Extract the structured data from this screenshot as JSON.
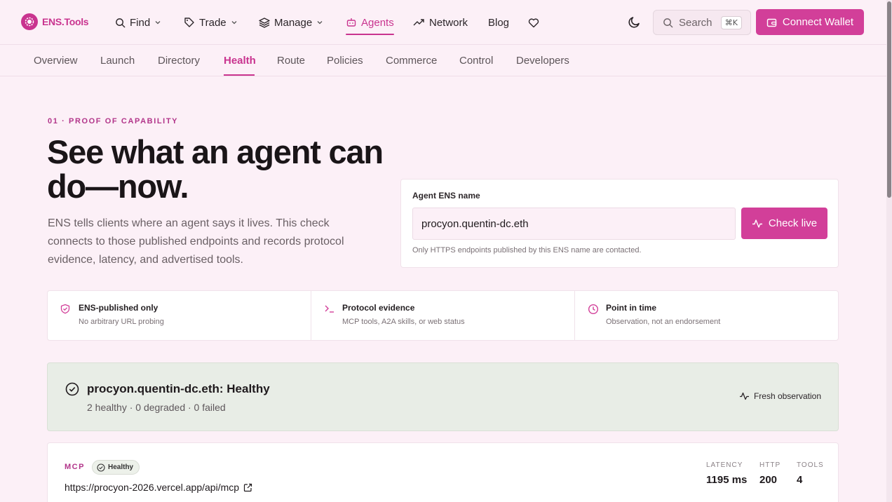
{
  "brand": {
    "name": "ENS.Tools"
  },
  "topnav": {
    "items": [
      {
        "label": "Find",
        "icon": "search-icon",
        "dropdown": true
      },
      {
        "label": "Trade",
        "icon": "tag-icon",
        "dropdown": true
      },
      {
        "label": "Manage",
        "icon": "layers-icon",
        "dropdown": true
      },
      {
        "label": "Agents",
        "icon": "bot-icon",
        "active": true
      },
      {
        "label": "Network",
        "icon": "trending-up-icon"
      },
      {
        "label": "Blog"
      }
    ],
    "search_label": "Search",
    "search_shortcut": "⌘K",
    "connect_label": "Connect Wallet"
  },
  "subnav": {
    "items": [
      "Overview",
      "Launch",
      "Directory",
      "Health",
      "Route",
      "Policies",
      "Commerce",
      "Control",
      "Developers"
    ],
    "active": "Health"
  },
  "hero": {
    "eyebrow": "01 · PROOF OF CAPABILITY",
    "title": "See what an agent can do—now.",
    "description": "ENS tells clients where an agent says it lives. This check connects to those published endpoints and records protocol evidence, latency, and advertised tools."
  },
  "check": {
    "label": "Agent ENS name",
    "value": "procyon.quentin-dc.eth",
    "button": "Check live",
    "hint": "Only HTTPS endpoints published by this ENS name are contacted."
  },
  "features": [
    {
      "title": "ENS-published only",
      "subtitle": "No arbitrary URL probing",
      "icon": "shield-check-icon"
    },
    {
      "title": "Protocol evidence",
      "subtitle": "MCP tools, A2A skills, or web status",
      "icon": "terminal-icon"
    },
    {
      "title": "Point in time",
      "subtitle": "Observation, not an endorsement",
      "icon": "clock-icon"
    }
  ],
  "status": {
    "title": "procyon.quentin-dc.eth: Healthy",
    "summary": "2 healthy · 0 degraded · 0 failed",
    "badge": "Fresh observation"
  },
  "endpoint": {
    "protocol": "MCP",
    "status": "Healthy",
    "url": "https://procyon-2026.vercel.app/api/mcp",
    "metrics": [
      {
        "label": "LATENCY",
        "value": "1195 ms"
      },
      {
        "label": "HTTP",
        "value": "200"
      },
      {
        "label": "TOOLS",
        "value": "4"
      }
    ]
  },
  "colors": {
    "accent": "#d23f99",
    "background": "#fcf0f7",
    "healthy_banner": "#e8ede6"
  }
}
